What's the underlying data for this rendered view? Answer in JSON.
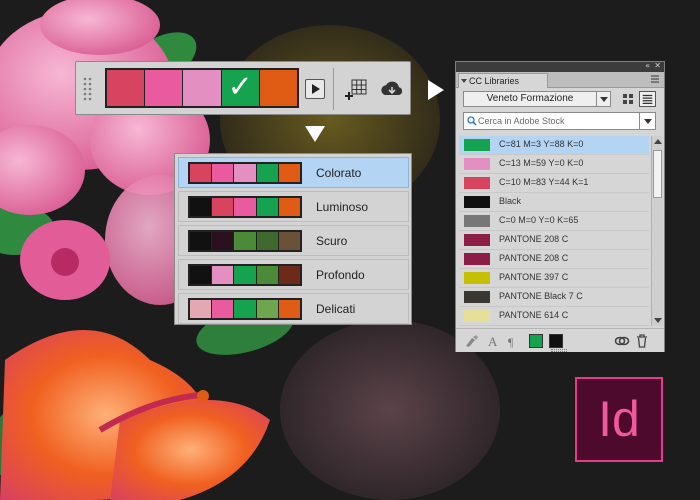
{
  "toolbar": {
    "swatches": [
      "#d8435f",
      "#ea5a9e",
      "#e38fc2",
      "#15a34f",
      "#e05b14"
    ],
    "selected_index": 3,
    "check_glyph": "✓",
    "icons": [
      "grip-icon",
      "play-icon",
      "add-grid-icon",
      "cloud-icon"
    ]
  },
  "theme_menu": {
    "items": [
      {
        "label": "Colorato",
        "selected": true,
        "colors": [
          "#d8435f",
          "#ea5a9e",
          "#e38fc2",
          "#15a34f",
          "#e05b14"
        ]
      },
      {
        "label": "Luminoso",
        "selected": false,
        "colors": [
          "#111111",
          "#d8435f",
          "#ea5a9e",
          "#15a34f",
          "#e05b14"
        ]
      },
      {
        "label": "Scuro",
        "selected": false,
        "colors": [
          "#111111",
          "#2b1020",
          "#4b8a37",
          "#3f6a2d",
          "#6b5137"
        ]
      },
      {
        "label": "Profondo",
        "selected": false,
        "colors": [
          "#111111",
          "#e38fc2",
          "#15a34f",
          "#4b8a37",
          "#6b2a1a"
        ]
      },
      {
        "label": "Delicati",
        "selected": false,
        "colors": [
          "#e3a9b3",
          "#ea5a9e",
          "#15a34f",
          "#6ea64e",
          "#e05b14"
        ]
      }
    ]
  },
  "panel": {
    "tab_label": "CC Libraries",
    "library_name": "Veneto Formazione",
    "search_placeholder": "Cerca in Adobe Stock",
    "items": [
      {
        "label": "C=81 M=3 Y=88 K=0",
        "color": "#15a34f",
        "selected": true
      },
      {
        "label": "C=13 M=59 Y=0 K=0",
        "color": "#e38fc2",
        "selected": false
      },
      {
        "label": "C=10 M=83 Y=44 K=1",
        "color": "#d8435f",
        "selected": false
      },
      {
        "label": "Black",
        "color": "#111111",
        "selected": false
      },
      {
        "label": "C=0 M=0 Y=0 K=65",
        "color": "#777777",
        "selected": false
      },
      {
        "label": "PANTONE 208 C",
        "color": "#8c1d47",
        "selected": false
      },
      {
        "label": "PANTONE 208 C",
        "color": "#8c1d47",
        "selected": false
      },
      {
        "label": "PANTONE 397 C",
        "color": "#c6c000",
        "selected": false
      },
      {
        "label": "PANTONE Black 7 C",
        "color": "#3b3733",
        "selected": false
      },
      {
        "label": "PANTONE 614 C",
        "color": "#e5df9a",
        "selected": false
      }
    ],
    "footer_icons": [
      "paint-brush-icon",
      "character-style-icon",
      "paragraph-style-icon",
      "green-swatch-icon",
      "black-swatch-icon",
      "link-icon",
      "trash-icon"
    ]
  },
  "logo": {
    "text": "Id",
    "accent": "#e43a8a"
  }
}
